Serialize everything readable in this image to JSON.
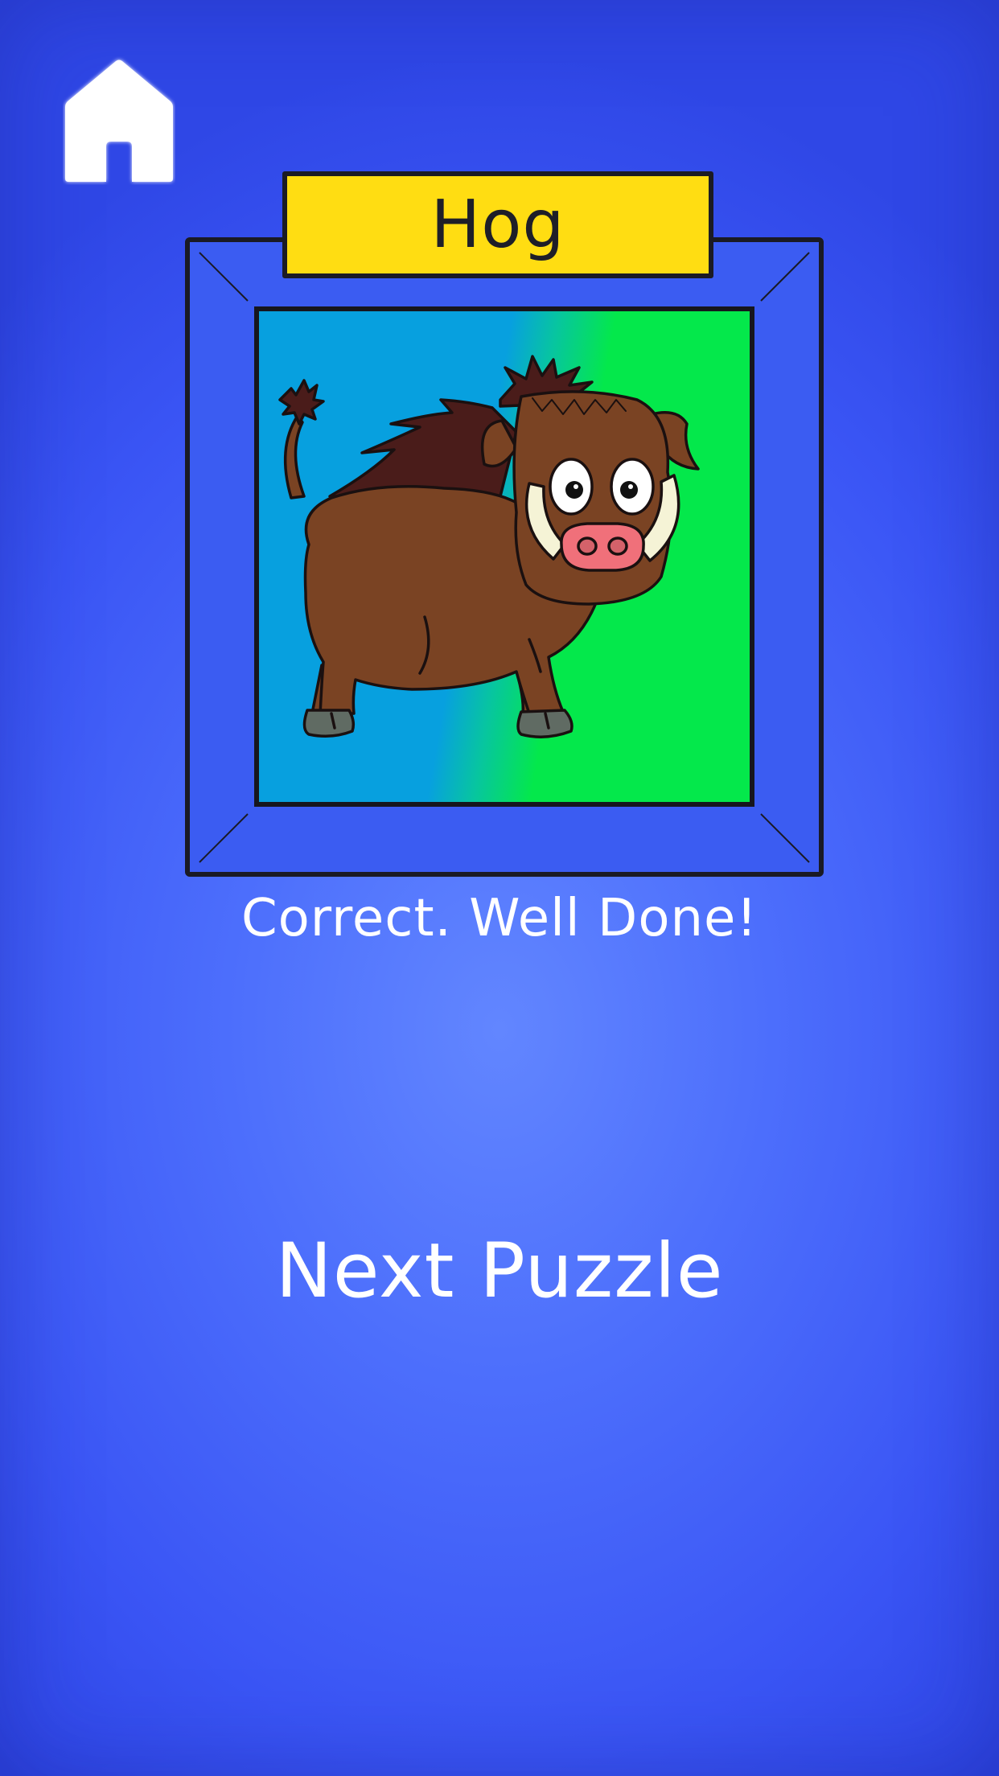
{
  "screen": {
    "background_color": "#4d6ffc"
  },
  "home_button": {
    "icon": "home-icon"
  },
  "puzzle": {
    "answer_label": "Hog",
    "image_subject": "hog",
    "plate_color": "#ffdd12",
    "frame_color": "#3b5cf2"
  },
  "result": {
    "message": "Correct. Well Done!"
  },
  "actions": {
    "next_label": "Next Puzzle"
  }
}
